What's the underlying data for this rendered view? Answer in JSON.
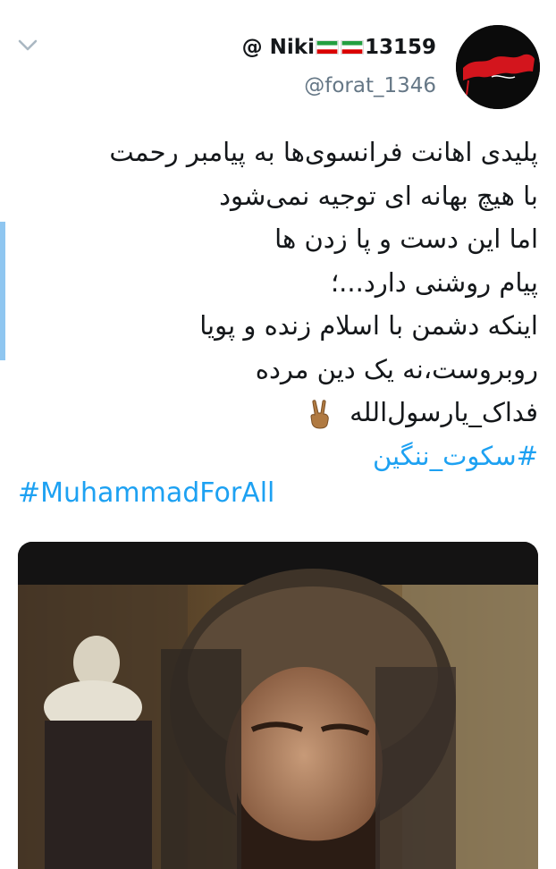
{
  "tweet": {
    "display_name": "Niki13159 @",
    "handle": "@forat_1346",
    "lines": [
      "پلیدی اهانت فرانسوی‌ها به پیامبر رحمت",
      "با هیچ بهانه ای توجیه نمی‌شود",
      "اما این دست و پا زدن ها",
      "پیام روشنی دارد...؛",
      "اینکه دشمن با اسلام زنده و پویا",
      "روبروست،نه یک دین مرده",
      "فداک_یارسول‌الله"
    ],
    "hashtag_fa": "#سکوت_ننگین",
    "hashtag_en": "#MuhammadForAll"
  },
  "colors": {
    "link": "#1da1f2",
    "text": "#14171a",
    "secondary": "#657786",
    "accent_bar": "#8fc6f0"
  },
  "icons": {
    "menu": "chevron-down-icon",
    "emoji": "victory-hand-icon"
  }
}
